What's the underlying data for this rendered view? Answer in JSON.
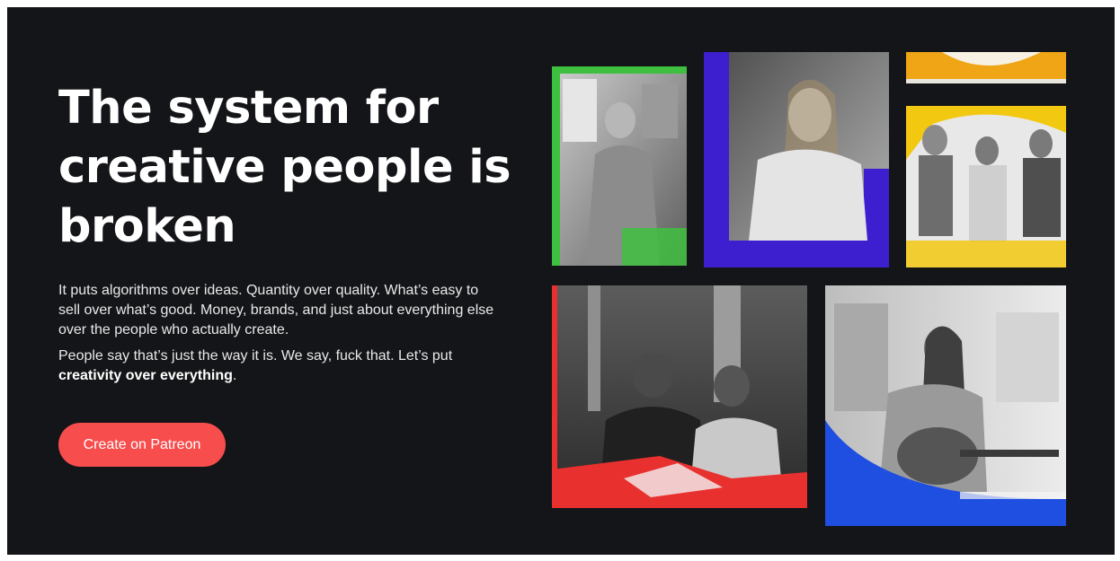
{
  "hero": {
    "headline": "The system for creative people is broken",
    "paragraph1": "It puts algorithms over ideas. Quantity over quality. What’s easy to sell over what’s good. Money, brands, and just about everything else over the people who actually create.",
    "paragraph2_lead": "People say that’s just the way it is. We say, fuck that. Let’s put ",
    "paragraph2_bold": "creativity over everything",
    "paragraph2_end": ".",
    "cta_label": "Create on Patreon"
  },
  "colors": {
    "background": "#141518",
    "cta": "#f74d4d",
    "accent_green": "#3fbf3f",
    "accent_purple": "#3d1fd0",
    "accent_orange": "#f0a516",
    "accent_yellow": "#f2c811",
    "accent_red": "#e8302f",
    "accent_blue": "#1f4fe0"
  },
  "collage": [
    {
      "id": "artist-with-glasses",
      "accent": "green"
    },
    {
      "id": "woman-at-desk",
      "accent": "purple"
    },
    {
      "id": "orange-strip",
      "accent": "orange"
    },
    {
      "id": "three-women",
      "accent": "yellow"
    },
    {
      "id": "podcast-duo",
      "accent": "red"
    },
    {
      "id": "guitar-player",
      "accent": "blue"
    }
  ]
}
